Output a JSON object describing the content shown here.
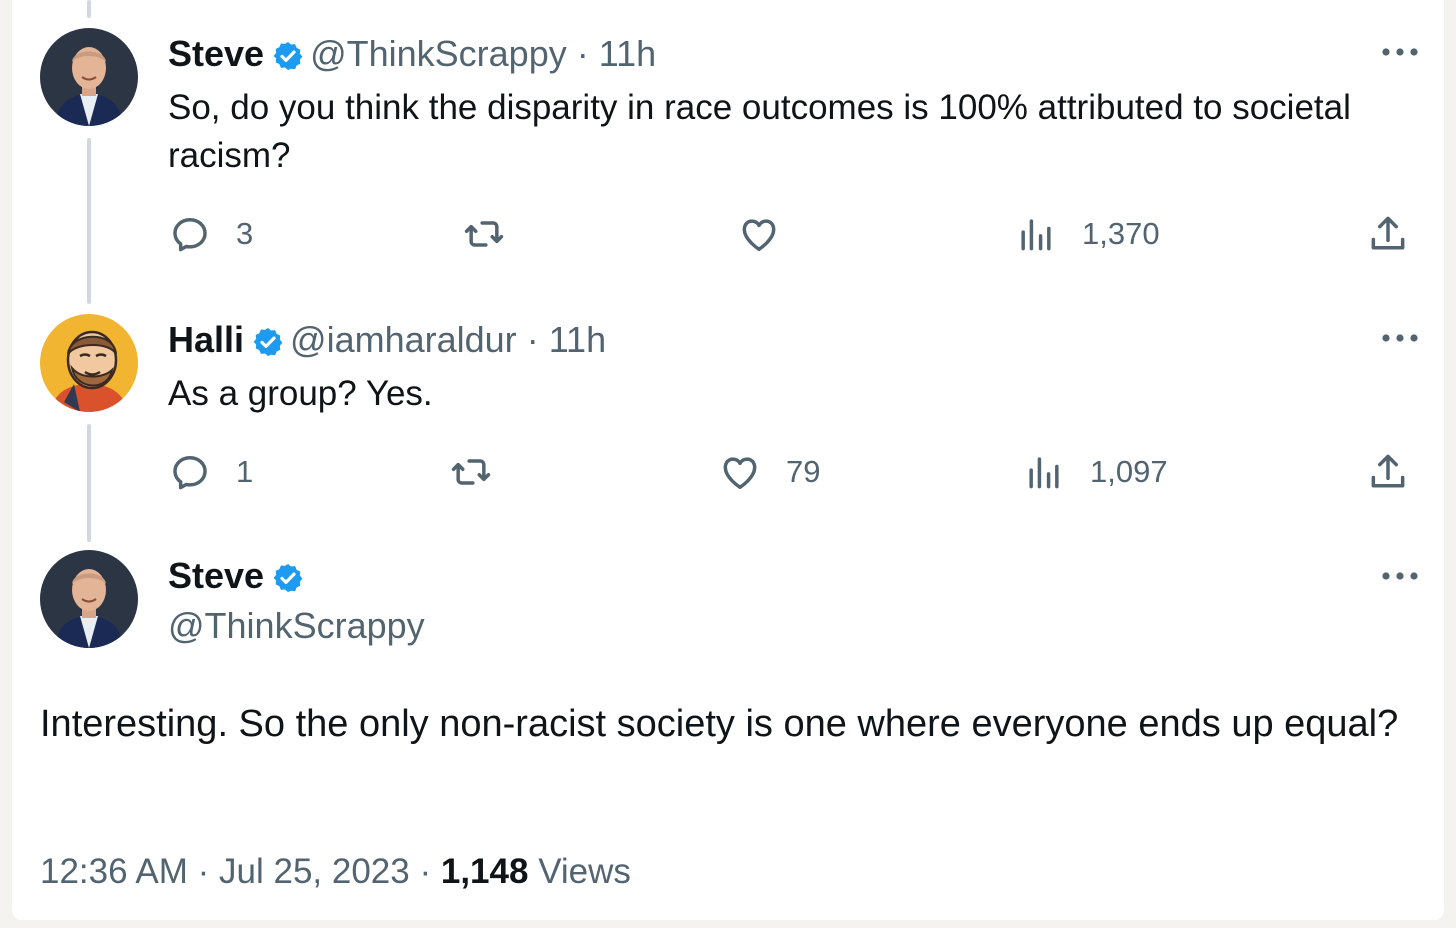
{
  "tweets": [
    {
      "name": "Steve",
      "handle": "@ThinkScrappy",
      "separator": "·",
      "time": "11h",
      "text": "So, do you think the disparity in race outcomes is 100% attributed to societal racism?",
      "replies": "3",
      "retweets": "",
      "likes": "",
      "views": "1,370"
    },
    {
      "name": "Halli",
      "handle": "@iamharaldur",
      "separator": "·",
      "time": "11h",
      "text": "As a group? Yes.",
      "replies": "1",
      "retweets": "",
      "likes": "79",
      "views": "1,097"
    }
  ],
  "main": {
    "name": "Steve",
    "handle": "@ThinkScrappy",
    "text": "Interesting. So the only non-racist society is one where everyone ends up equal?",
    "time": "12:36 AM",
    "sep1": "·",
    "date": "Jul 25, 2023",
    "sep2": "·",
    "views_count": "1,148",
    "views_label": "Views"
  },
  "icons": {
    "reply": "reply-icon",
    "retweet": "retweet-icon",
    "like": "heart-icon",
    "views": "analytics-icon",
    "share": "share-icon",
    "more": "more-icon",
    "verified": "verified-badge-icon"
  },
  "colors": {
    "verified": "#1d9bf0",
    "secondary_text": "#536471",
    "primary_text": "#0f1419",
    "thread_line": "#cfd9de"
  }
}
